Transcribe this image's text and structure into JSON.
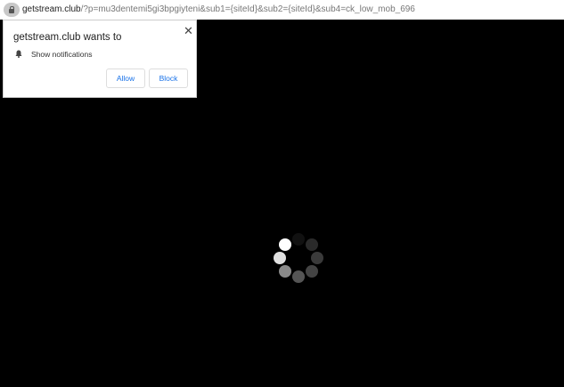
{
  "address_bar": {
    "domain": "getstream.club",
    "path": "/?p=mu3dentemi5gi3bpgiyteni&sub1={siteId}&sub2={siteId}&sub4=ck_low_mob_696"
  },
  "permission_popup": {
    "title": "getstream.club wants to",
    "permission": "Show notifications",
    "allow_label": "Allow",
    "block_label": "Block",
    "close_label": "✕"
  },
  "spinner": {
    "dot_colors": [
      "#111111",
      "#2a2a2a",
      "#3a3a3a",
      "#444444",
      "#555555",
      "#8a8a8a",
      "#e0e0e0",
      "#ffffff"
    ]
  }
}
